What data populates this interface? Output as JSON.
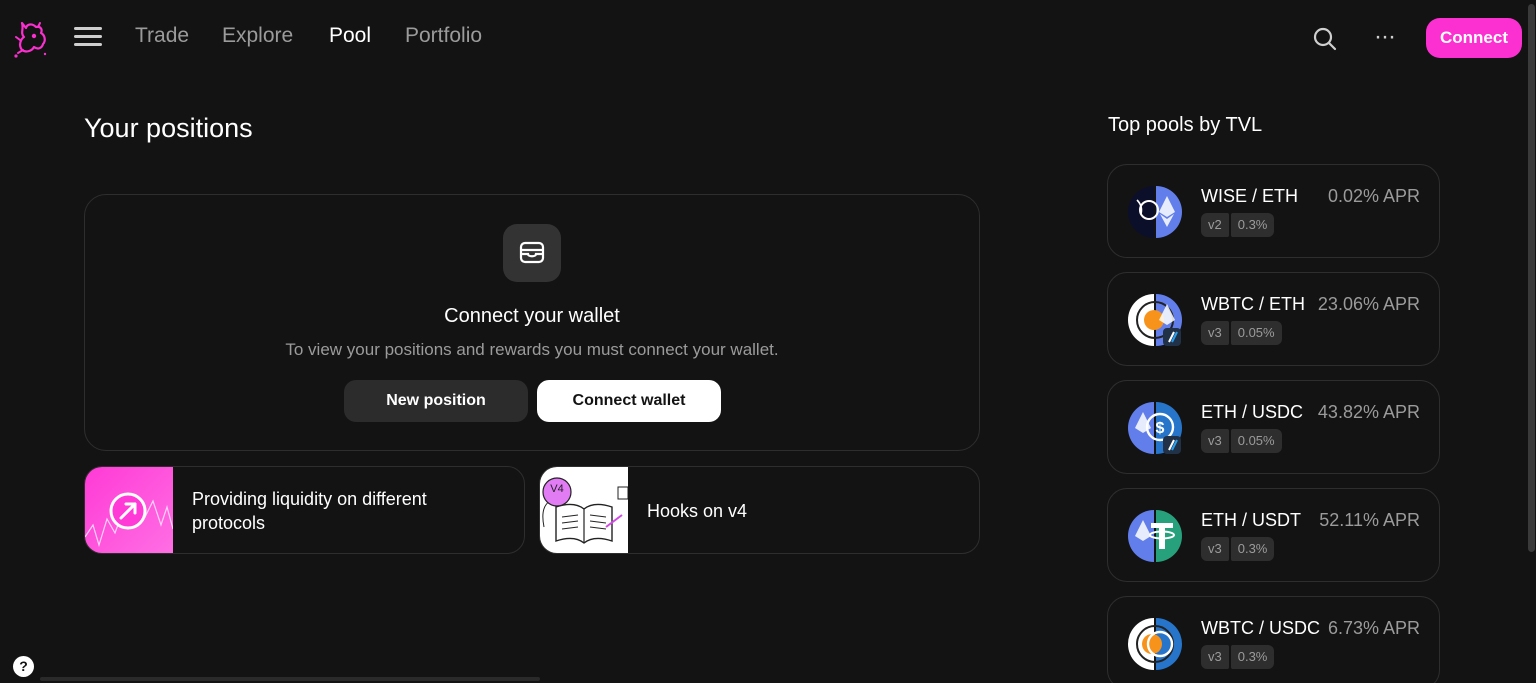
{
  "nav": {
    "links": [
      {
        "label": "Trade",
        "active": false
      },
      {
        "label": "Explore",
        "active": false
      },
      {
        "label": "Pool",
        "active": true
      },
      {
        "label": "Portfolio",
        "active": false
      }
    ],
    "more_label": "···",
    "connect_label": "Connect"
  },
  "positions": {
    "title": "Your positions",
    "wallet_heading": "Connect your wallet",
    "wallet_sub": "To view your positions and rewards you must connect your wallet.",
    "new_position_label": "New position",
    "connect_wallet_label": "Connect wallet",
    "learn_cards": [
      {
        "title": "Providing liquidity on different protocols"
      },
      {
        "title": "Hooks on v4",
        "thumb_badge": "V4"
      }
    ]
  },
  "pools": {
    "title": "Top pools by TVL",
    "items": [
      {
        "pair": "WISE / ETH",
        "apr": "0.02% APR",
        "version": "v2",
        "fee": "0.3%"
      },
      {
        "pair": "WBTC / ETH",
        "apr": "23.06% APR",
        "version": "v3",
        "fee": "0.05%"
      },
      {
        "pair": "ETH / USDC",
        "apr": "43.82% APR",
        "version": "v3",
        "fee": "0.05%"
      },
      {
        "pair": "ETH / USDT",
        "apr": "52.11% APR",
        "version": "v3",
        "fee": "0.3%"
      },
      {
        "pair": "WBTC / USDC",
        "apr": "6.73% APR",
        "version": "v3",
        "fee": "0.3%"
      }
    ]
  },
  "help_label": "?",
  "colors": {
    "background": "#131313",
    "accent": "#fc2fd0",
    "muted_text": "#9b9b9b",
    "card_border": "#2e2e2e"
  }
}
